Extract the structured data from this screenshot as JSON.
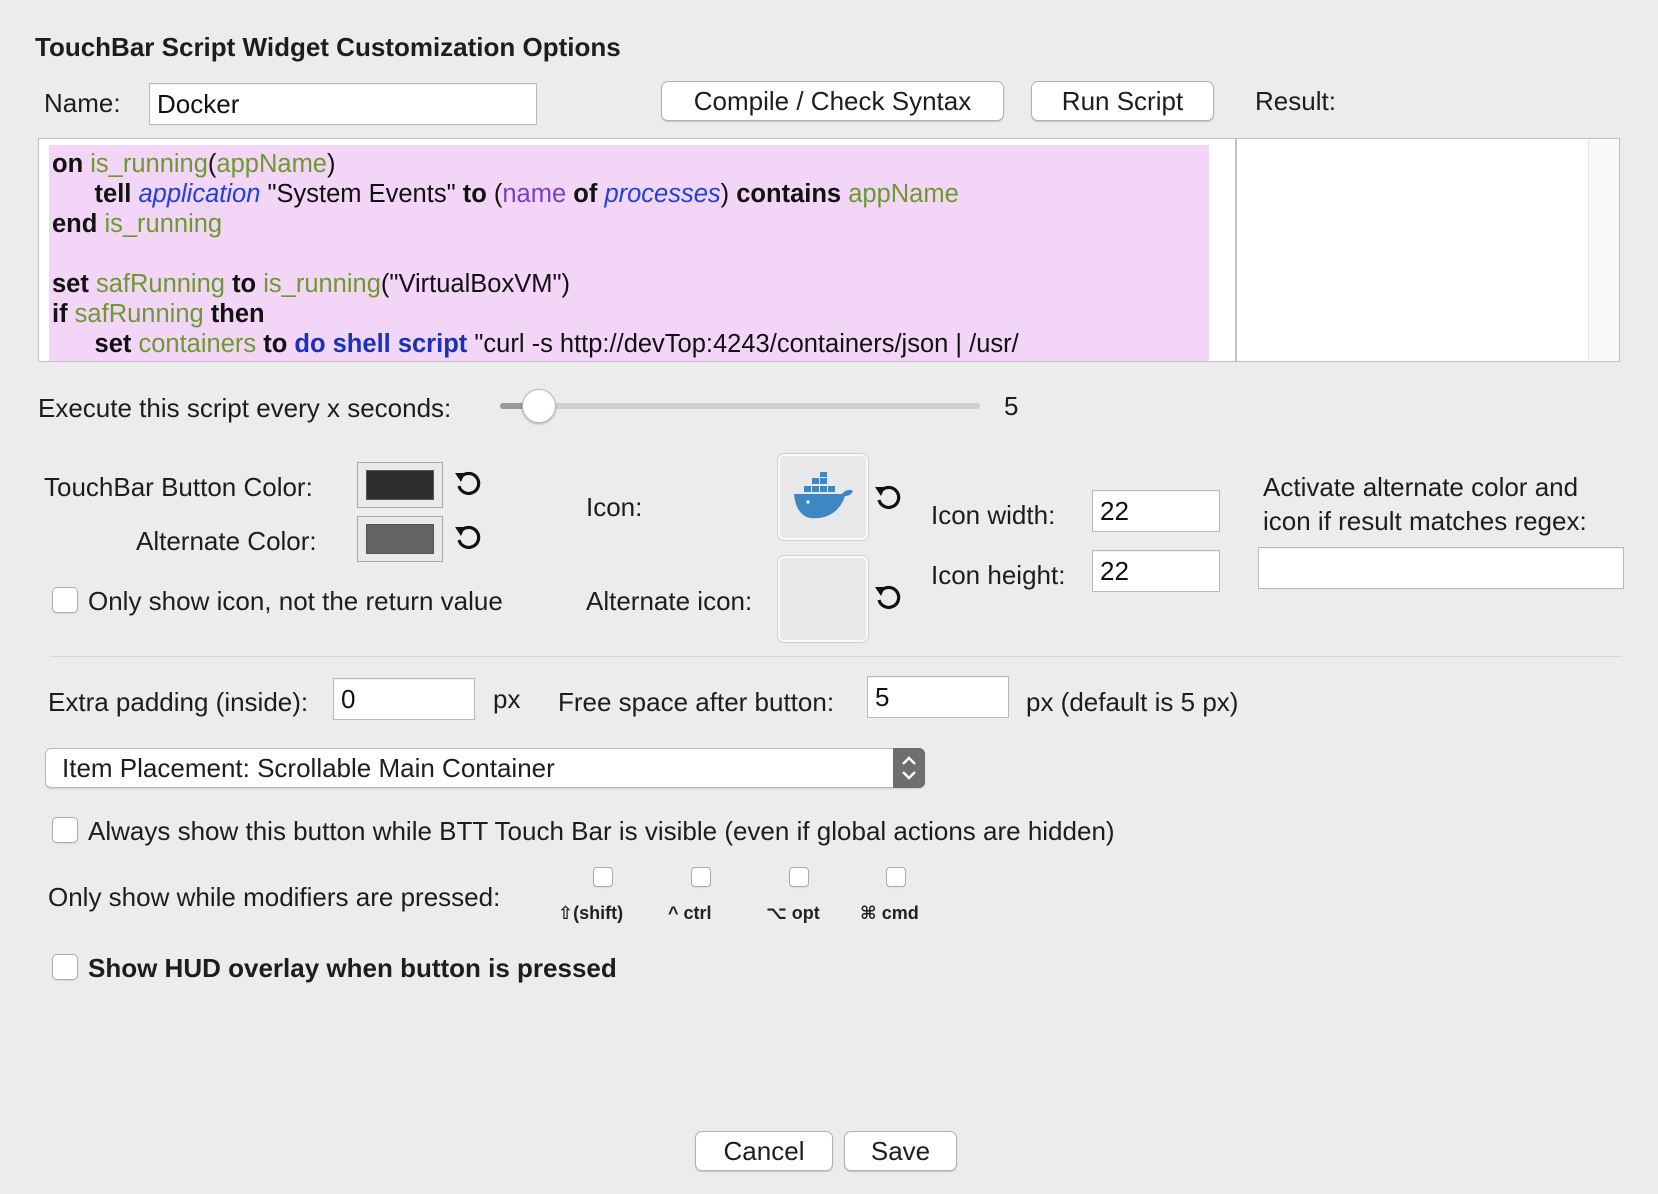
{
  "window": {
    "title": "TouchBar Script Widget Customization Options"
  },
  "name_field": {
    "label": "Name:",
    "value": "Docker"
  },
  "buttons": {
    "compile": "Compile / Check Syntax",
    "run": "Run Script",
    "cancel": "Cancel",
    "save": "Save"
  },
  "result": {
    "label": "Result:",
    "value": ""
  },
  "script": {
    "lines": [
      "on is_running(appName)",
      "tell application \"System Events\" to (name of processes) contains appName",
      "end is_running",
      "",
      "set safRunning to is_running(\"VirtualBoxVM\")",
      "if safRunning then",
      "set containers to do shell script \"curl -s http://devTop:4243/containers/json | /usr/"
    ],
    "background": "#f2d5f7"
  },
  "interval": {
    "label": "Execute this script every x seconds:",
    "value": 5,
    "fraction": 0.08
  },
  "colors": {
    "button_color_label": "TouchBar Button Color:",
    "button_color": "#2e2e2e",
    "alternate_color_label": "Alternate Color:",
    "alternate_color": "#636363"
  },
  "icons": {
    "icon_label": "Icon:",
    "icon_name": "docker-whale-icon",
    "alternate_icon_label": "Alternate icon:",
    "width_label": "Icon width:",
    "width_value": "22",
    "height_label": "Icon height:",
    "height_value": "22"
  },
  "regex": {
    "label_line1": "Activate alternate color and",
    "label_line2": "icon if result matches regex:",
    "value": ""
  },
  "only_icon": {
    "label": "Only show icon, not the return value",
    "checked": false
  },
  "padding": {
    "label": "Extra padding (inside):",
    "value": "0",
    "unit": "px",
    "free_space_label": "Free space after button:",
    "free_space_value": "5",
    "free_space_unit": "px (default is 5 px)"
  },
  "placement": {
    "selected": "Item Placement: Scrollable Main Container"
  },
  "always_show": {
    "label": "Always show this button while BTT Touch Bar is visible (even if global actions are hidden)",
    "checked": false
  },
  "modifiers": {
    "label": "Only show while modifiers are pressed:",
    "items": [
      {
        "label": "⇧(shift)"
      },
      {
        "label": "^ ctrl"
      },
      {
        "label": "⌥ opt"
      },
      {
        "label": "⌘ cmd"
      }
    ]
  },
  "hud": {
    "label": "Show HUD overlay when button is pressed",
    "checked": false
  }
}
